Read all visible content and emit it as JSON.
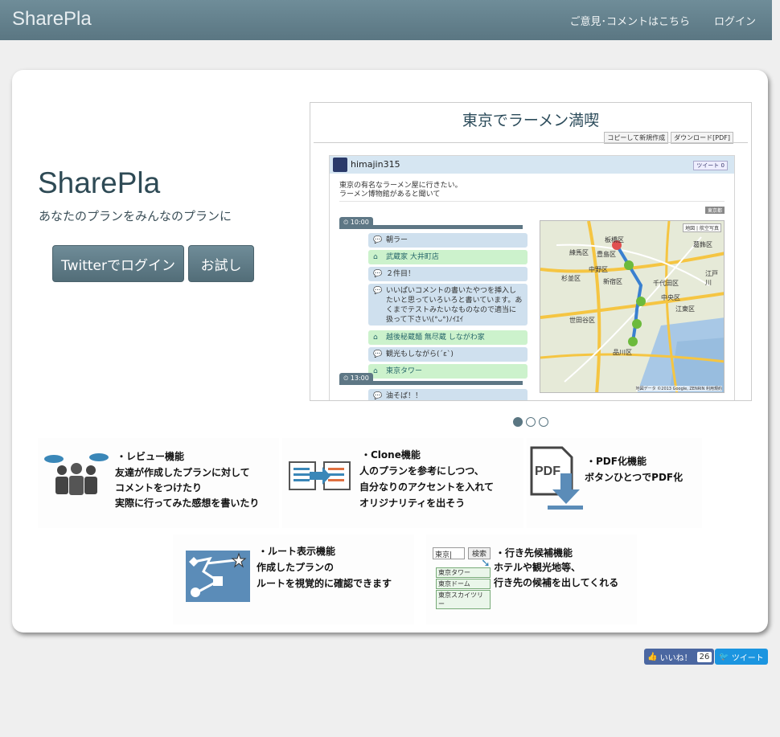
{
  "navbar": {
    "brand": "SharePla",
    "feedback": "ご意見･コメントはこちら",
    "login": "ログイン"
  },
  "hero": {
    "title": "SharePla",
    "subtitle": "あなたのプランをみんなのプランに",
    "twitter_login": "Twitterでログイン",
    "try": "お試し"
  },
  "carousel": {
    "slide_title": "東京でラーメン満喫",
    "copy_tab": "コピーして新規作成",
    "pdf_tab": "ダウンロード[PDF]",
    "user": "himajin315",
    "tweet_mini": "ツイート",
    "tweet_count": "0",
    "desc1": "東京の有名なラーメン屋に行きたい。",
    "desc2": "ラーメン博物館があると聞いて",
    "tag": "東京都",
    "time1": "10:00",
    "time2": "13:00",
    "entries": [
      "朝ラー",
      "武蔵家 大井町店",
      "２件目！",
      "いいぱいコメントの書いたやつを挿入したいと思っていろいろと書いています。あくまでテストみたいなものなので適当に扱って下さい\\(°ᴗ°)ﾉｲｴｲ",
      "越後秘蔵麺 無尽蔵 しながわ家",
      "観光もしながら(ˊεˋ)",
      "東京タワー",
      "油そば！！"
    ],
    "map_labels": [
      "板橋区",
      "豊島区",
      "練馬区",
      "葛飾区",
      "杉並区",
      "新宿区",
      "江戸川",
      "中野区",
      "世田谷区",
      "中央区",
      "江東区",
      "品川区",
      "千代田区"
    ],
    "map_buttons": [
      "地図",
      "航空写真"
    ],
    "map_footer": "地図データ ©2013 Google, ZENRIN  利用規約"
  },
  "features": {
    "review": {
      "title": "・レビュー機能",
      "l1": "友達が作成したプランに対して",
      "l2": "コメントをつけたり",
      "l3": "実際に行ってみた感想を書いたり"
    },
    "clone": {
      "title": "・Clone機能",
      "l1": "人のプランを参考にしつつ、",
      "l2": "自分なりのアクセントを入れて",
      "l3": "オリジナリティを出そう"
    },
    "pdf": {
      "title": "・PDF化機能",
      "l1": "ボタンひとつでPDF化",
      "icon_text": "PDF"
    },
    "route": {
      "title": "・ルート表示機能",
      "l1": "作成したプランの",
      "l2": "ルートを視覚的に確認できます"
    },
    "suggest": {
      "title": "・行き先候補機能",
      "l1": "ホテルや観光地等、",
      "l2": "行き先の候補を出してくれる",
      "input": "東京|",
      "button": "検索",
      "options": [
        "東京タワー",
        "東京ドーム",
        "東京スカイツリー"
      ]
    }
  },
  "social": {
    "like": "いいね！",
    "like_count": "26",
    "tweet": "ツイート"
  },
  "colors": {
    "navbar": "#5a7682",
    "button": "#607e8a",
    "like": "#4b67a1",
    "tweet": "#1b95e0"
  }
}
